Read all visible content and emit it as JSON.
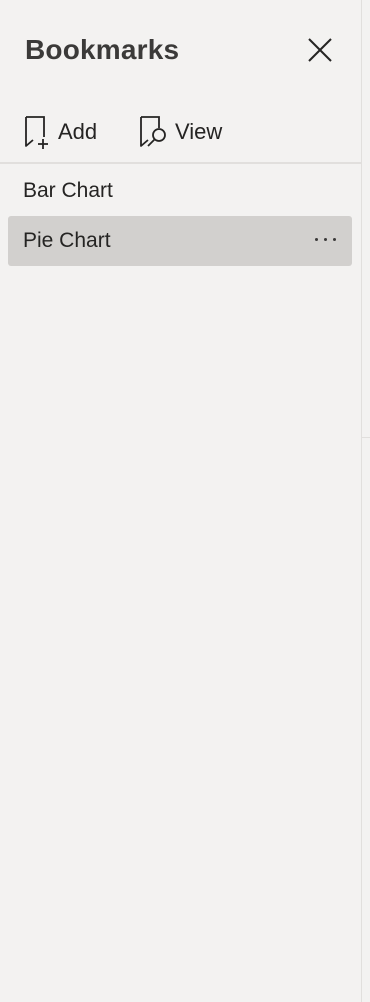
{
  "panel": {
    "title": "Bookmarks",
    "close_icon": "close-icon"
  },
  "toolbar": {
    "add_label": "Add",
    "add_icon": "bookmark-add-icon",
    "view_label": "View",
    "view_icon": "bookmark-view-icon"
  },
  "bookmarks": [
    {
      "label": "Bar Chart",
      "selected": false
    },
    {
      "label": "Pie Chart",
      "selected": true
    }
  ],
  "colors": {
    "background": "#f3f2f1",
    "selected_item": "#d2d0ce",
    "text": "#252423",
    "divider": "#e1dfdd"
  }
}
